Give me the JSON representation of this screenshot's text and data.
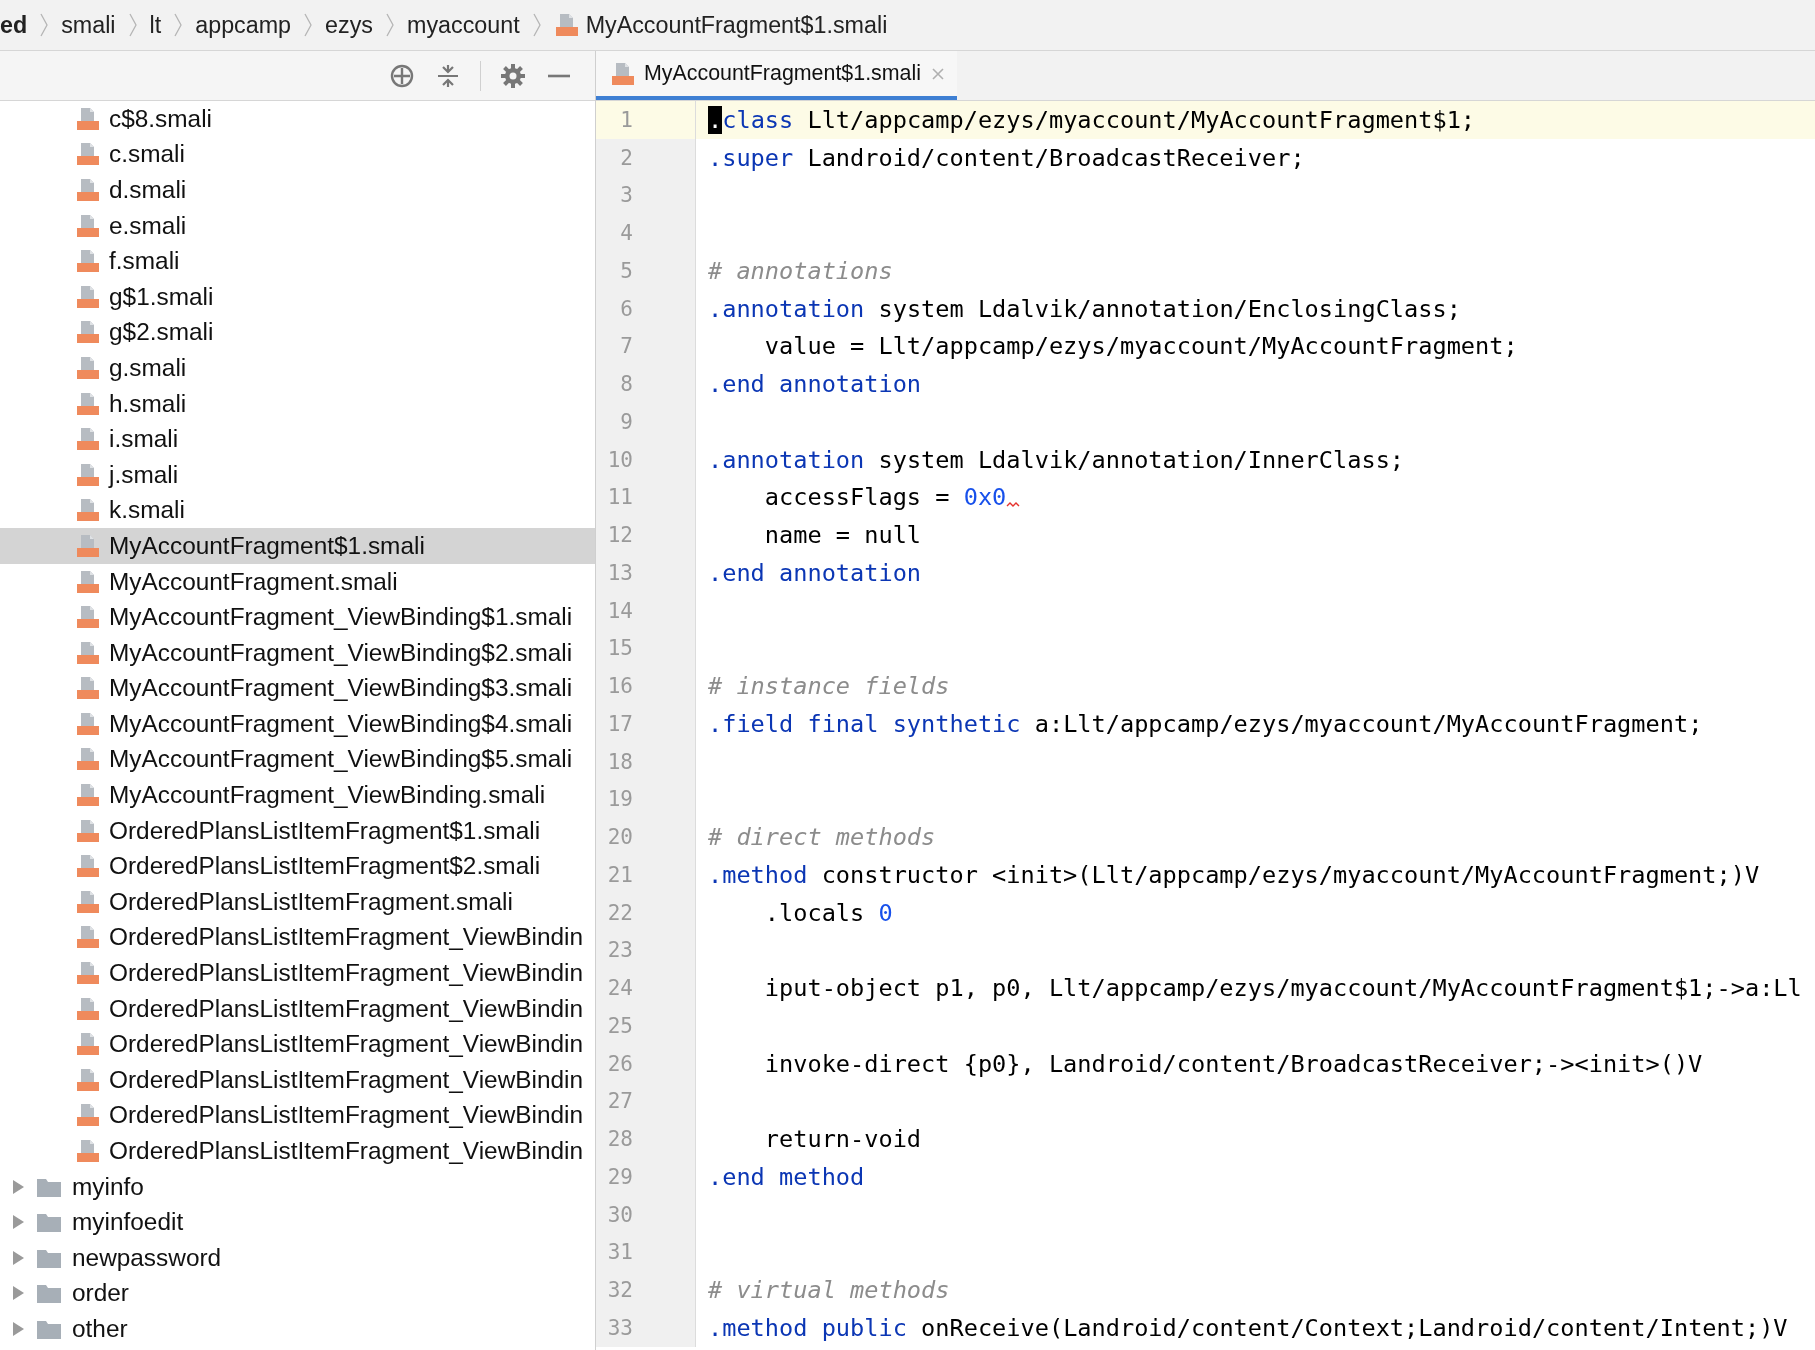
{
  "breadcrumb": [
    {
      "label": "ed",
      "bold": true,
      "file": false
    },
    {
      "label": "smali",
      "bold": false,
      "file": false
    },
    {
      "label": "lt",
      "bold": false,
      "file": false
    },
    {
      "label": "appcamp",
      "bold": false,
      "file": false
    },
    {
      "label": "ezys",
      "bold": false,
      "file": false
    },
    {
      "label": "myaccount",
      "bold": false,
      "file": false
    },
    {
      "label": "MyAccountFragment$1.smali",
      "bold": false,
      "file": true
    }
  ],
  "tree": {
    "files": [
      {
        "name": "c$8.smali",
        "selected": false
      },
      {
        "name": "c.smali",
        "selected": false
      },
      {
        "name": "d.smali",
        "selected": false
      },
      {
        "name": "e.smali",
        "selected": false
      },
      {
        "name": "f.smali",
        "selected": false
      },
      {
        "name": "g$1.smali",
        "selected": false
      },
      {
        "name": "g$2.smali",
        "selected": false
      },
      {
        "name": "g.smali",
        "selected": false
      },
      {
        "name": "h.smali",
        "selected": false
      },
      {
        "name": "i.smali",
        "selected": false
      },
      {
        "name": "j.smali",
        "selected": false
      },
      {
        "name": "k.smali",
        "selected": false
      },
      {
        "name": "MyAccountFragment$1.smali",
        "selected": true
      },
      {
        "name": "MyAccountFragment.smali",
        "selected": false
      },
      {
        "name": "MyAccountFragment_ViewBinding$1.smali",
        "selected": false
      },
      {
        "name": "MyAccountFragment_ViewBinding$2.smali",
        "selected": false
      },
      {
        "name": "MyAccountFragment_ViewBinding$3.smali",
        "selected": false
      },
      {
        "name": "MyAccountFragment_ViewBinding$4.smali",
        "selected": false
      },
      {
        "name": "MyAccountFragment_ViewBinding$5.smali",
        "selected": false
      },
      {
        "name": "MyAccountFragment_ViewBinding.smali",
        "selected": false
      },
      {
        "name": "OrderedPlansListItemFragment$1.smali",
        "selected": false
      },
      {
        "name": "OrderedPlansListItemFragment$2.smali",
        "selected": false
      },
      {
        "name": "OrderedPlansListItemFragment.smali",
        "selected": false
      },
      {
        "name": "OrderedPlansListItemFragment_ViewBindin",
        "selected": false
      },
      {
        "name": "OrderedPlansListItemFragment_ViewBindin",
        "selected": false
      },
      {
        "name": "OrderedPlansListItemFragment_ViewBindin",
        "selected": false
      },
      {
        "name": "OrderedPlansListItemFragment_ViewBindin",
        "selected": false
      },
      {
        "name": "OrderedPlansListItemFragment_ViewBindin",
        "selected": false
      },
      {
        "name": "OrderedPlansListItemFragment_ViewBindin",
        "selected": false
      },
      {
        "name": "OrderedPlansListItemFragment_ViewBindin",
        "selected": false
      }
    ],
    "folders": [
      {
        "name": "myinfo",
        "expanded": false
      },
      {
        "name": "myinfoedit",
        "expanded": false
      },
      {
        "name": "newpassword",
        "expanded": false
      },
      {
        "name": "order",
        "expanded": false
      },
      {
        "name": "other",
        "expanded": false
      }
    ]
  },
  "tabs": [
    {
      "label": "MyAccountFragment$1.smali",
      "selected": true
    }
  ],
  "editor": {
    "lines": [
      {
        "number": "1",
        "current": true,
        "tokens": [
          {
            "kind": "cursor",
            "text": "."
          },
          {
            "kind": "keyword",
            "text": "class"
          },
          {
            "kind": "plain",
            "text": " Llt/appcamp/ezys/myaccount/MyAccountFragment$1;"
          }
        ]
      },
      {
        "number": "2",
        "current": false,
        "tokens": [
          {
            "kind": "keyword",
            "text": ".super"
          },
          {
            "kind": "plain",
            "text": " Landroid/content/BroadcastReceiver;"
          }
        ]
      },
      {
        "number": "3",
        "current": false
      },
      {
        "number": "4",
        "current": false
      },
      {
        "number": "5",
        "current": false,
        "tokens": [
          {
            "kind": "comment",
            "text": "# annotations"
          }
        ]
      },
      {
        "number": "6",
        "current": false,
        "tokens": [
          {
            "kind": "keyword",
            "text": ".annotation"
          },
          {
            "kind": "plain",
            "text": " system Ldalvik/annotation/EnclosingClass;"
          }
        ]
      },
      {
        "number": "7",
        "current": false,
        "tokens": [
          {
            "kind": "plain",
            "text": "    value = Llt/appcamp/ezys/myaccount/MyAccountFragment;"
          }
        ]
      },
      {
        "number": "8",
        "current": false,
        "tokens": [
          {
            "kind": "keyword",
            "text": ".end annotation"
          }
        ]
      },
      {
        "number": "9",
        "current": false
      },
      {
        "number": "10",
        "current": false,
        "tokens": [
          {
            "kind": "keyword",
            "text": ".annotation"
          },
          {
            "kind": "plain",
            "text": " system Ldalvik/annotation/InnerClass;"
          }
        ]
      },
      {
        "number": "11",
        "current": false,
        "tokens": [
          {
            "kind": "plain",
            "text": "    accessFlags = "
          },
          {
            "kind": "number",
            "text": "0x0"
          },
          {
            "kind": "squiggle"
          }
        ]
      },
      {
        "number": "12",
        "current": false,
        "tokens": [
          {
            "kind": "plain",
            "text": "    name = null"
          }
        ]
      },
      {
        "number": "13",
        "current": false,
        "tokens": [
          {
            "kind": "keyword",
            "text": ".end annotation"
          }
        ]
      },
      {
        "number": "14",
        "current": false
      },
      {
        "number": "15",
        "current": false
      },
      {
        "number": "16",
        "current": false,
        "tokens": [
          {
            "kind": "comment",
            "text": "# instance fields"
          }
        ]
      },
      {
        "number": "17",
        "current": false,
        "tokens": [
          {
            "kind": "keyword",
            "text": ".field final synthetic"
          },
          {
            "kind": "plain",
            "text": " a:Llt/appcamp/ezys/myaccount/MyAccountFragment;"
          }
        ]
      },
      {
        "number": "18",
        "current": false
      },
      {
        "number": "19",
        "current": false
      },
      {
        "number": "20",
        "current": false,
        "tokens": [
          {
            "kind": "comment",
            "text": "# direct methods"
          }
        ]
      },
      {
        "number": "21",
        "current": false,
        "tokens": [
          {
            "kind": "keyword",
            "text": ".method"
          },
          {
            "kind": "plain",
            "text": " constructor <init>(Llt/appcamp/ezys/myaccount/MyAccountFragment;)V"
          }
        ]
      },
      {
        "number": "22",
        "current": false,
        "tokens": [
          {
            "kind": "plain",
            "text": "    .locals "
          },
          {
            "kind": "number",
            "text": "0"
          }
        ]
      },
      {
        "number": "23",
        "current": false
      },
      {
        "number": "24",
        "current": false,
        "tokens": [
          {
            "kind": "plain",
            "text": "    iput-object p1, p0, Llt/appcamp/ezys/myaccount/MyAccountFragment$1;->a:Ll"
          }
        ]
      },
      {
        "number": "25",
        "current": false
      },
      {
        "number": "26",
        "current": false,
        "tokens": [
          {
            "kind": "plain",
            "text": "    invoke-direct {p0}, Landroid/content/BroadcastReceiver;-><init>()V"
          }
        ]
      },
      {
        "number": "27",
        "current": false
      },
      {
        "number": "28",
        "current": false,
        "tokens": [
          {
            "kind": "plain",
            "text": "    return-void"
          }
        ]
      },
      {
        "number": "29",
        "current": false,
        "tokens": [
          {
            "kind": "keyword",
            "text": ".end method"
          }
        ]
      },
      {
        "number": "30",
        "current": false
      },
      {
        "number": "31",
        "current": false
      },
      {
        "number": "32",
        "current": false,
        "tokens": [
          {
            "kind": "comment",
            "text": "# virtual methods"
          }
        ]
      },
      {
        "number": "33",
        "current": false,
        "tokens": [
          {
            "kind": "keyword",
            "text": ".method public"
          },
          {
            "kind": "plain",
            "text": " onReceive(Landroid/content/Context;Landroid/content/Intent;)V"
          }
        ]
      }
    ]
  }
}
